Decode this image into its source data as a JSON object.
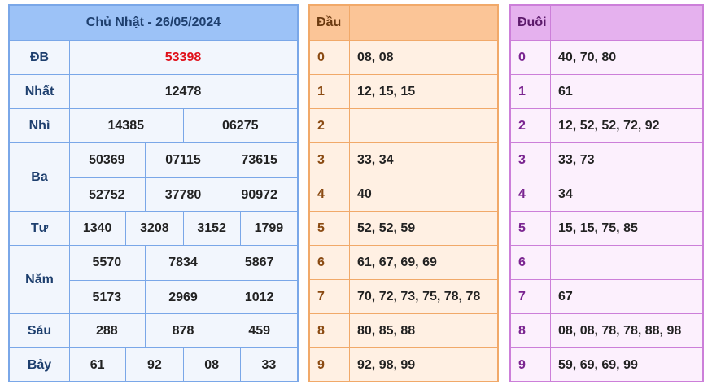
{
  "main": {
    "title": "Chủ Nhật - 26/05/2024",
    "rows": [
      {
        "label": "ĐB",
        "lines": [
          [
            "53398"
          ]
        ]
      },
      {
        "label": "Nhất",
        "lines": [
          [
            "12478"
          ]
        ]
      },
      {
        "label": "Nhì",
        "lines": [
          [
            "14385",
            "06275"
          ]
        ]
      },
      {
        "label": "Ba",
        "lines": [
          [
            "50369",
            "07115",
            "73615"
          ],
          [
            "52752",
            "37780",
            "90972"
          ]
        ]
      },
      {
        "label": "Tư",
        "lines": [
          [
            "1340",
            "3208",
            "3152",
            "1799"
          ]
        ]
      },
      {
        "label": "Năm",
        "lines": [
          [
            "5570",
            "7834",
            "5867"
          ],
          [
            "5173",
            "2969",
            "1012"
          ]
        ]
      },
      {
        "label": "Sáu",
        "lines": [
          [
            "288",
            "878",
            "459"
          ]
        ]
      },
      {
        "label": "Bảy",
        "lines": [
          [
            "61",
            "92",
            "08",
            "33"
          ]
        ]
      }
    ]
  },
  "dau": {
    "header": "Đầu",
    "rows": [
      {
        "k": "0",
        "v": "08, 08"
      },
      {
        "k": "1",
        "v": "12, 15, 15"
      },
      {
        "k": "2",
        "v": ""
      },
      {
        "k": "3",
        "v": "33, 34"
      },
      {
        "k": "4",
        "v": "40"
      },
      {
        "k": "5",
        "v": "52, 52, 59"
      },
      {
        "k": "6",
        "v": "61, 67, 69, 69"
      },
      {
        "k": "7",
        "v": "70, 72, 73, 75, 78, 78"
      },
      {
        "k": "8",
        "v": "80, 85, 88"
      },
      {
        "k": "9",
        "v": "92, 98, 99"
      }
    ]
  },
  "duoi": {
    "header": "Đuôi",
    "rows": [
      {
        "k": "0",
        "v": "40, 70, 80"
      },
      {
        "k": "1",
        "v": "61"
      },
      {
        "k": "2",
        "v": "12, 52, 52, 72, 92"
      },
      {
        "k": "3",
        "v": "33, 73"
      },
      {
        "k": "4",
        "v": "34"
      },
      {
        "k": "5",
        "v": "15, 15, 75, 85"
      },
      {
        "k": "6",
        "v": ""
      },
      {
        "k": "7",
        "v": "67"
      },
      {
        "k": "8",
        "v": "08, 08, 78, 78, 88, 98"
      },
      {
        "k": "9",
        "v": "59, 69, 69, 99"
      }
    ]
  },
  "colors": {
    "special_prize": "#e0101a",
    "main_border": "#7aa7e8",
    "dau_border": "#f1a969",
    "duoi_border": "#cc7fd9"
  }
}
